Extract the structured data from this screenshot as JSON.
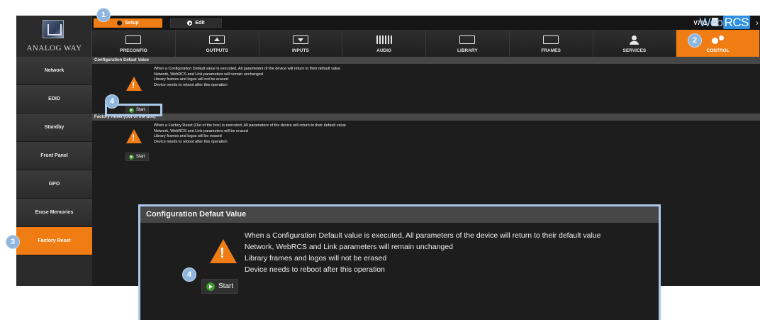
{
  "topbar": {
    "setup_label": "Setup",
    "edit_label": "Edit",
    "version": "V701",
    "brand_web": "Web",
    "brand_rcs": "RCS",
    "more": "›"
  },
  "logo": {
    "text": "ANALOG WAY"
  },
  "nav": {
    "items": [
      {
        "label": "PRECONFIG",
        "icon": "preconfig-icon"
      },
      {
        "label": "OUTPUTS",
        "icon": "outputs-icon"
      },
      {
        "label": "INPUTS",
        "icon": "inputs-icon"
      },
      {
        "label": "AUDIO",
        "icon": "audio-icon"
      },
      {
        "label": "LIBRARY",
        "icon": "library-icon"
      },
      {
        "label": "FRAMES",
        "icon": "frames-icon"
      },
      {
        "label": "SERVICES",
        "icon": "services-icon"
      },
      {
        "label": "CONTROL",
        "icon": "gears-icon",
        "active": true
      }
    ]
  },
  "sidebar": {
    "items": [
      {
        "label": "Network"
      },
      {
        "label": "EDID"
      },
      {
        "label": "Standby"
      },
      {
        "label": "Front Panel"
      },
      {
        "label": "GPO"
      },
      {
        "label": "Erase Memories"
      },
      {
        "label": "Factory Reset",
        "active": true
      }
    ]
  },
  "sections": {
    "config_default": {
      "title": "Configuration Defaut Value",
      "lines": [
        "When a Configuration Default value is executed, All parameters of the device will return to their default value",
        "Network, WebRCS and Link parameters will remain unchanged",
        "Library frames and logos will not be erased",
        "Device needs to reboot after this operation"
      ],
      "button": "Start"
    },
    "factory_reset": {
      "title": "Factory Reset (Out of the Box)",
      "lines": [
        "When a Factory Reset (Out of the box) is executed, All parameters of the device will return to their default value",
        "Network, WebRCS and Link parameters will be erased",
        "Library frames and logos will be erased",
        "Device needs to reboot after this operation"
      ],
      "button": "Start"
    }
  },
  "badges": [
    "1",
    "2",
    "3",
    "4",
    "4"
  ],
  "colors": {
    "accent": "#f07c14",
    "highlight": "#a9c9ea",
    "badge": "#8fb6df",
    "go": "#3f9a2e"
  }
}
